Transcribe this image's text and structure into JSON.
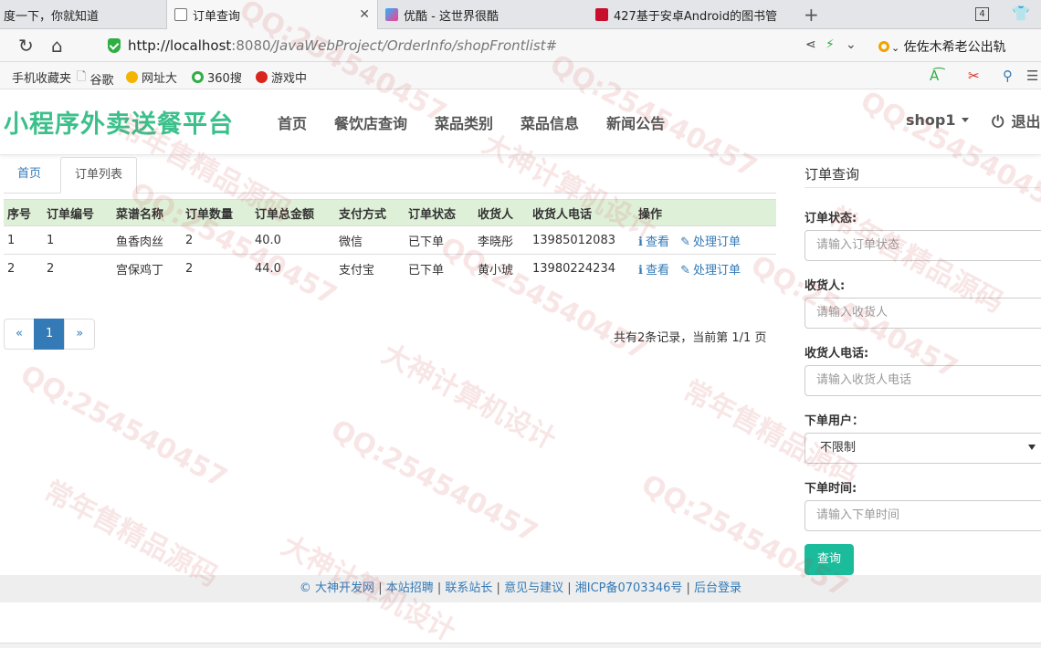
{
  "browser": {
    "tabs": [
      {
        "title": "度一下，你就知道",
        "active": false
      },
      {
        "title": "订单查询",
        "active": true
      },
      {
        "title": "优酷 - 这世界很酷",
        "active": false
      },
      {
        "title": "427基于安卓Android的图书管",
        "active": false
      }
    ],
    "tab_count": "4",
    "url_host": "http://localhost",
    "url_port": ":8080",
    "url_path": "/JavaWebProject/OrderInfo/shopFrontlist#",
    "search_engine_label": "佐佐木希老公出轨",
    "bookmarks": [
      "手机收藏夹",
      "谷歌",
      "网址大",
      "360搜",
      "游戏中"
    ]
  },
  "header": {
    "brand": "小程序外卖送餐平台",
    "nav": [
      "首页",
      "餐饮店查询",
      "菜品类别",
      "菜品信息",
      "新闻公告"
    ],
    "user": "shop1",
    "logout": "退出"
  },
  "content": {
    "tabs": [
      "首页",
      "订单列表"
    ],
    "table": {
      "columns": [
        "序号",
        "订单编号",
        "菜谱名称",
        "订单数量",
        "订单总金额",
        "支付方式",
        "订单状态",
        "收货人",
        "收货人电话",
        "操作"
      ],
      "rows": [
        {
          "no": "1",
          "order_id": "1",
          "dish": "鱼香肉丝",
          "qty": "2",
          "amount": "40.0",
          "pay": "微信",
          "status": "已下单",
          "receiver": "李晓彤",
          "phone": "13985012083"
        },
        {
          "no": "2",
          "order_id": "2",
          "dish": "宫保鸡丁",
          "qty": "2",
          "amount": "44.0",
          "pay": "支付宝",
          "status": "已下单",
          "receiver": "黄小琥",
          "phone": "13980224234"
        }
      ],
      "view_label": "查看",
      "process_label": "处理订单"
    },
    "pager": {
      "prev": "«",
      "current": "1",
      "next": "»"
    },
    "page_info": "共有2条记录，当前第 1/1 页"
  },
  "search_panel": {
    "title": "订单查询",
    "status_label": "订单状态:",
    "status_placeholder": "请输入订单状态",
    "receiver_label": "收货人:",
    "receiver_placeholder": "请输入收货人",
    "phone_label": "收货人电话:",
    "phone_placeholder": "请输入收货人电话",
    "user_label": "下单用户：",
    "user_value": "不限制",
    "time_label": "下单时间:",
    "time_placeholder": "请输入下单时间",
    "submit": "查询"
  },
  "footer": {
    "copyright": "© 大神开发网",
    "links": [
      "本站招聘",
      "联系站长",
      "意见与建议",
      "湘ICP备0703346号",
      "后台登录"
    ]
  },
  "watermark": {
    "qq": "QQ:254540457",
    "slogan1": "常年售精品源码",
    "slogan2": "大神计算机设计"
  }
}
